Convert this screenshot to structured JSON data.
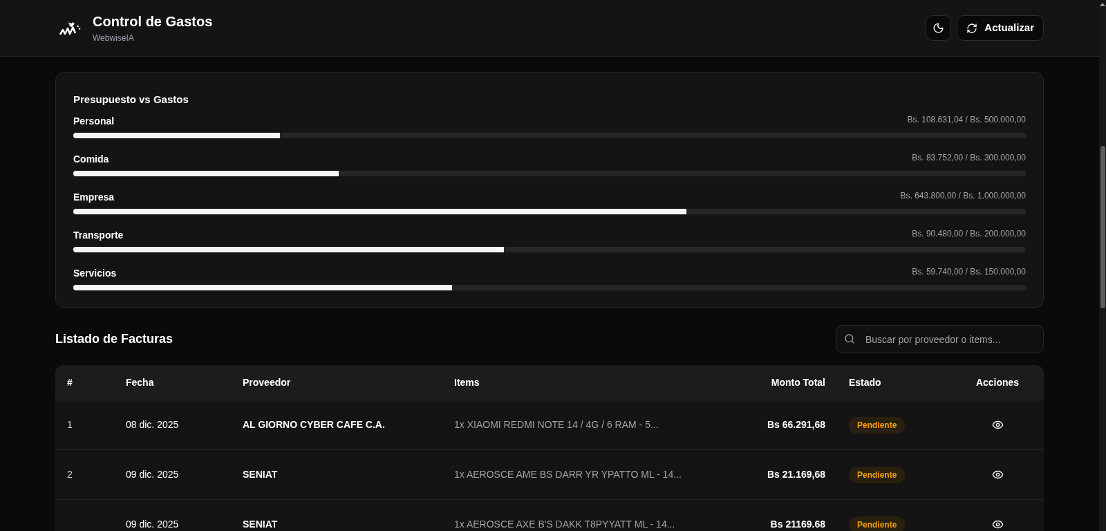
{
  "header": {
    "title": "Control de Gastos",
    "subtitle": "WebwiseIA",
    "refresh_button": {
      "label": "Actualizar"
    }
  },
  "budget": {
    "title": "Presupuesto vs Gastos",
    "categories": [
      {
        "name": "Personal",
        "reading": "Bs. 108.631,04 / Bs. 500.000,00",
        "level": 0.217
      },
      {
        "name": "Comida",
        "reading": "Bs. 83.752,00 / Bs. 300.000,00",
        "level": 0.279
      },
      {
        "name": "Empresa",
        "reading": "Bs. 643.800,00 / Bs. 1.000.000,00",
        "level": 0.644
      },
      {
        "name": "Transporte",
        "reading": "Bs. 90.480,00 / Bs. 200.000,00",
        "level": 0.452
      },
      {
        "name": "Servicios",
        "reading": "Bs. 59.740,00 / Bs. 150.000,00",
        "level": 0.398
      }
    ]
  },
  "invoices": {
    "title": "Listado de Facturas",
    "search": {
      "placeholder": "Buscar por proveedor o items..."
    },
    "columns": [
      "#",
      "Fecha",
      "Proveedor",
      "Items",
      "Monto Total",
      "Estado",
      "Acciones"
    ],
    "rows": [
      {
        "number": "1",
        "date": "08 dic. 2025",
        "provider": "AL GIORNO CYBER CAFE C.A.",
        "items": "1x XIAOMI REDMI NOTE 14 / 4G / 6 RAM - 5...",
        "total": "Bs 66.291,68",
        "status": {
          "label": "Pendiente",
          "kind": "pending"
        }
      },
      {
        "number": "2",
        "date": "09 dic. 2025",
        "provider": "SENIAT",
        "items": "1x AEROSCE AME BS DARR YR YPATTO ML - 14...",
        "total": "Bs 21.169,68",
        "status": {
          "label": "Pendiente",
          "kind": "pending"
        }
      },
      {
        "date": "09 dic. 2025",
        "provider": "SENIAT",
        "items": "1x AEROSCE AXE B'S DAKK T8PYYATT ML - 14...",
        "total": "Bs 21169.68",
        "status": {
          "label": "Pendiente",
          "kind": "pending"
        }
      }
    ]
  }
}
